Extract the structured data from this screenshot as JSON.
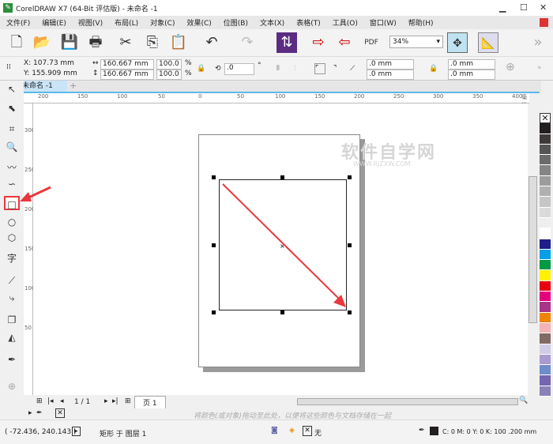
{
  "window": {
    "title": "CorelDRAW X7 (64-Bit 评估版) - 未命名 -1",
    "logo": "CorelDRAW"
  },
  "menu": [
    "文件(F)",
    "编辑(E)",
    "视图(V)",
    "布局(L)",
    "对象(C)",
    "效果(C)",
    "位图(B)",
    "文本(X)",
    "表格(T)",
    "工具(O)",
    "窗口(W)",
    "帮助(H)"
  ],
  "toolbar": {
    "zoom_value": "34%",
    "icons": [
      "new-icon",
      "open-icon",
      "save-icon",
      "print-icon",
      "cut-icon",
      "copy-icon",
      "paste-icon",
      "undo-icon",
      "redo-icon",
      "corel-connect-icon",
      "import-icon",
      "export-icon",
      "pdf-icon",
      "full-screen-icon",
      "rulers-icon"
    ]
  },
  "properties": {
    "x": "X: 107.73 mm",
    "y": "Y: 155.909 mm",
    "width": "160.667 mm",
    "height": "160.667 mm",
    "scale_x": "100.0",
    "scale_y": "100.0",
    "percent": "%",
    "rotation": ".0",
    "degree": "°",
    "corner1": ".0 mm",
    "corner2": ".0 mm",
    "corner3": ".0 mm",
    "corner4": ".0 mm"
  },
  "document_tab": "未命名 -1",
  "ruler": {
    "h_labels": [
      "200",
      "150",
      "100",
      "50",
      "0",
      "50",
      "100",
      "150",
      "200",
      "250",
      "300",
      "350",
      "400"
    ],
    "unit": "毫米",
    "v_labels": [
      "300",
      "250",
      "200",
      "150",
      "100",
      "50"
    ]
  },
  "watermark": {
    "line1": "软件自学网",
    "line2": "WWW.RJZXW.COM"
  },
  "page_nav": {
    "current": "1 / 1",
    "page_tab": "页 1"
  },
  "document_palette_hint": "将颜色(或对象)拖动至此处，以便将这些颜色与文档存储在一起",
  "status": {
    "cursor": "( -72.436, 240.143 )",
    "object": "矩形 于 图层 1",
    "fill": "无",
    "outline": "C: 0 M: 0 Y: 0 K: 100  .200 mm"
  },
  "palette": [
    "#231f20",
    "#3e3a39",
    "#555555",
    "#6b6b6b",
    "#858585",
    "#9c9c9c",
    "#b0b0b0",
    "#c6c6c6",
    "#dadada",
    "#eeeeee",
    "#ffffff",
    "#1d2088",
    "#00a0e9",
    "#009944",
    "#fff100",
    "#e60012",
    "#e4007f",
    "#a8348a",
    "#f08300",
    "#f5b2b2",
    "#7f6b63",
    "#d0cce8",
    "#a99bd0",
    "#6f8ccc",
    "#7466b0",
    "#8b80b8"
  ],
  "colors": {
    "accent_red": "#e8383d",
    "selection": "#c9e4f7"
  }
}
